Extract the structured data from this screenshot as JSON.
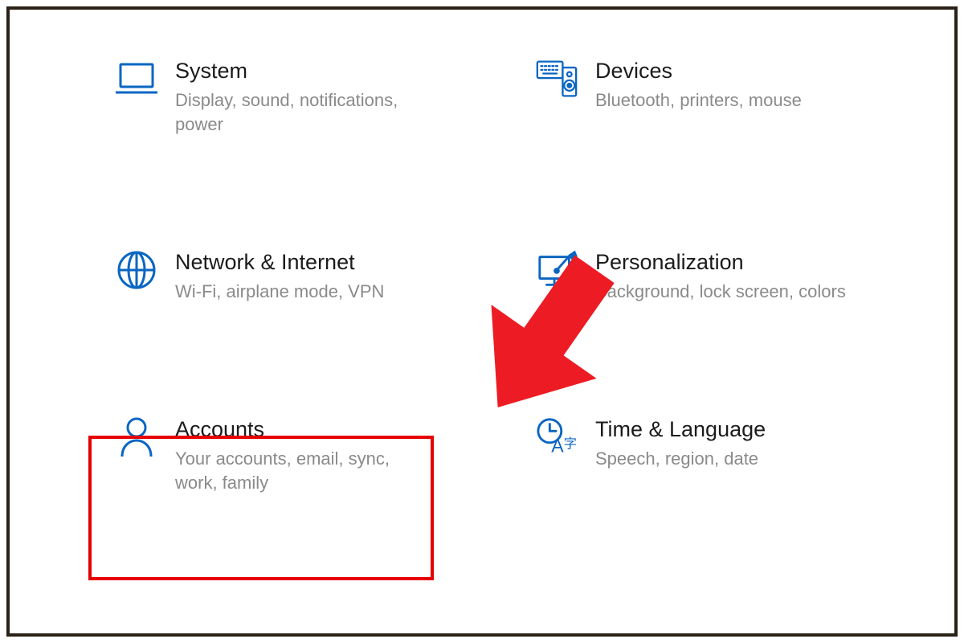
{
  "colors": {
    "iconBlue": "#0a66c2",
    "titleText": "#1b1b1b",
    "descText": "#8a8a8a",
    "highlightRed": "#e60000"
  },
  "tiles": {
    "system": {
      "title": "System",
      "desc": "Display, sound, notifications, power"
    },
    "devices": {
      "title": "Devices",
      "desc": "Bluetooth, printers, mouse"
    },
    "network": {
      "title": "Network & Internet",
      "desc": "Wi-Fi, airplane mode, VPN"
    },
    "personalization": {
      "title": "Personalization",
      "desc": "Background, lock screen, colors"
    },
    "accounts": {
      "title": "Accounts",
      "desc": "Your accounts, email, sync, work, family"
    },
    "timeLanguage": {
      "title": "Time & Language",
      "desc": "Speech, region, date"
    }
  }
}
